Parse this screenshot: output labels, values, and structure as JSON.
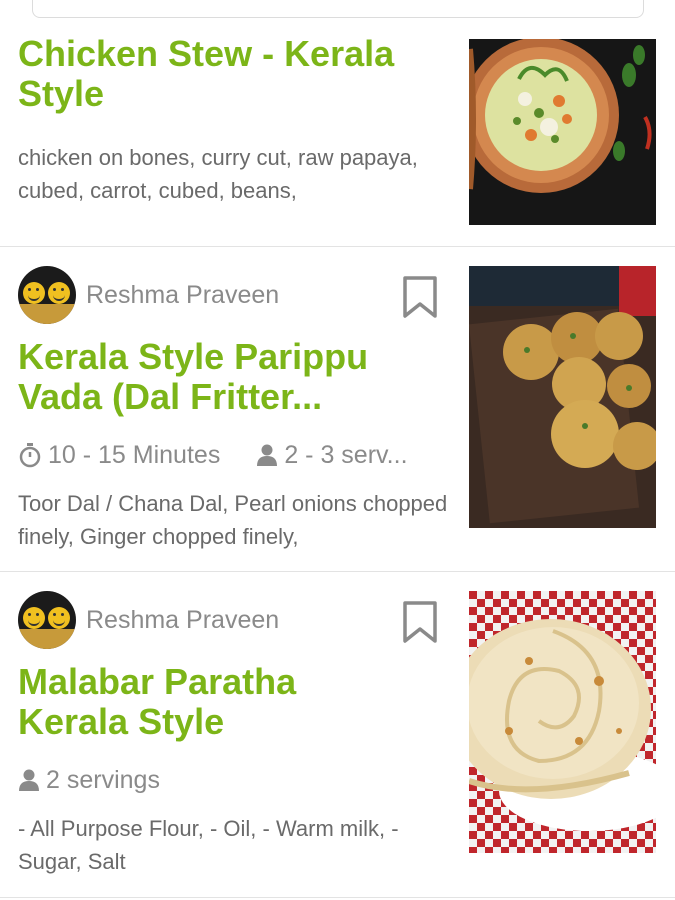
{
  "cards": [
    {
      "title": "Chicken Stew - Kerala Style",
      "ingredients": "chicken on bones, curry cut, raw papaya, cubed, carrot, cubed, beans,"
    },
    {
      "author": "Reshma Praveen",
      "title_line1": "Kerala Style Parippu",
      "title_line2": "Vada (Dal Fritter...",
      "time": "10 - 15 Minutes",
      "servings": "2 - 3 serv...",
      "ingredients": "Toor Dal / Chana Dal, Pearl onions chopped finely, Ginger chopped finely,"
    },
    {
      "author": "Reshma Praveen",
      "title_line1": "Malabar Paratha",
      "title_line2": "Kerala Style",
      "servings": "2 servings",
      "ingredients": "- All Purpose Flour, - Oil, - Warm milk, - Sugar, Salt"
    }
  ],
  "icons": {
    "timer": "timer-icon",
    "person": "person-icon",
    "bookmark": "bookmark-icon"
  },
  "colors": {
    "title_green": "#7cb518",
    "meta_gray": "#8a8a8a",
    "text_gray": "#6a6a6a"
  }
}
